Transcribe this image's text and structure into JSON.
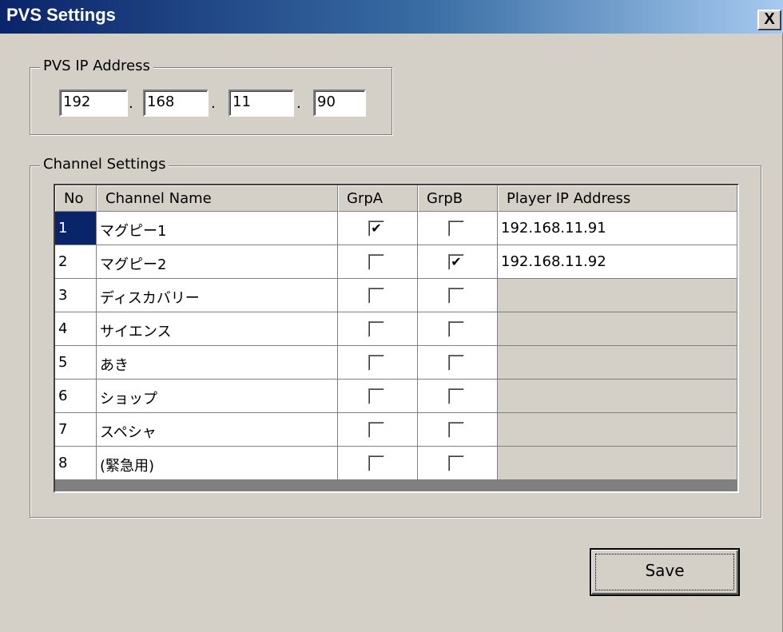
{
  "window": {
    "title": "PVS Settings",
    "close_glyph": "X"
  },
  "ip_group": {
    "label": "PVS IP Address",
    "octets": [
      "192",
      "168",
      "11",
      "90"
    ],
    "separator": "."
  },
  "channel_group": {
    "label": "Channel Settings",
    "columns": [
      "No",
      "Channel Name",
      "GrpA",
      "GrpB",
      "Player IP Address"
    ],
    "rows": [
      {
        "no": "1",
        "name": "マグピー1",
        "grpA": true,
        "grpB": false,
        "ip": "192.168.11.91"
      },
      {
        "no": "2",
        "name": "マグピー2",
        "grpA": false,
        "grpB": true,
        "ip": "192.168.11.92"
      },
      {
        "no": "3",
        "name": "ディスカバリー",
        "grpA": false,
        "grpB": false,
        "ip": ""
      },
      {
        "no": "4",
        "name": "サイエンス",
        "grpA": false,
        "grpB": false,
        "ip": ""
      },
      {
        "no": "5",
        "name": "あき",
        "grpA": false,
        "grpB": false,
        "ip": ""
      },
      {
        "no": "6",
        "name": "ショップ",
        "grpA": false,
        "grpB": false,
        "ip": ""
      },
      {
        "no": "7",
        "name": "スペシャ",
        "grpA": false,
        "grpB": false,
        "ip": ""
      },
      {
        "no": "8",
        "name": "(緊急用)",
        "grpA": false,
        "grpB": false,
        "ip": ""
      }
    ],
    "selected_row": 0
  },
  "buttons": {
    "save_label": "Save"
  },
  "colors": {
    "title_gradient_start": "#0a246a",
    "title_gradient_end": "#a6caf0",
    "dialog_face": "#d4d0c8",
    "selection": "#0a246a"
  }
}
